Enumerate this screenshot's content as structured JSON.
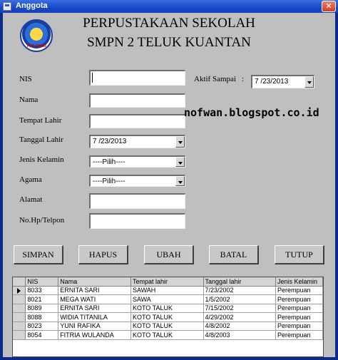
{
  "window": {
    "title": "Anggota",
    "close_glyph": "✕"
  },
  "header": {
    "line1": "PERPUSTAKAAN SEKOLAH",
    "line2": "SMPN 2 TELUK KUANTAN",
    "logo_icon": "school-emblem-icon"
  },
  "form": {
    "nis_label": "NIS",
    "nis_value": "",
    "nama_label": "Nama",
    "nama_value": "",
    "tempat_lahir_label": "Tempat Lahir",
    "tempat_lahir_value": "",
    "tanggal_lahir_label": "Tanggal Lahir",
    "tanggal_lahir_value": "7 /23/2013",
    "jenis_kelamin_label": "Jenis Kelamin",
    "jenis_kelamin_value": "----Pilih----",
    "agama_label": "Agama",
    "agama_value": "----Pilih----",
    "alamat_label": "Alamat",
    "alamat_value": "",
    "nohp_label": "No.Hp/Telpon",
    "nohp_value": "",
    "aktif_label": "Aktif Sampai",
    "aktif_colon": ":",
    "aktif_value": "7 /23/2013"
  },
  "watermark": "nofwan.blogspot.co.id",
  "buttons": {
    "simpan": "SIMPAN",
    "hapus": "HAPUS",
    "ubah": "UBAH",
    "batal": "BATAL",
    "tutup": "TUTUP"
  },
  "grid": {
    "columns": [
      "NIS",
      "Nama",
      "Tempat lahir",
      "Tanggal lahir",
      "Jenis Kelamin"
    ],
    "rows": [
      [
        "8033",
        "ERNITA SARI",
        "SAWAH",
        "7/23/2002",
        "Perempuan"
      ],
      [
        "8021",
        "MEGA WATI",
        "SAWA",
        "1/5/2002",
        "Perempuan"
      ],
      [
        "8089",
        "ERNITA SARI",
        "KOTO TALUK",
        "7/15/2002",
        "Perempuan"
      ],
      [
        "8088",
        "WIDIA TITANILA",
        "KOTO TALUK",
        "4/29/2002",
        "Perempuan"
      ],
      [
        "8023",
        "YUNI RAFIKA",
        "KOTO TALUK",
        "4/8/2002",
        "Perempuan"
      ],
      [
        "8054",
        "FITRIA WULANDA",
        "KOTO TALUK",
        "4/8/2003",
        "Perempuan"
      ]
    ]
  }
}
